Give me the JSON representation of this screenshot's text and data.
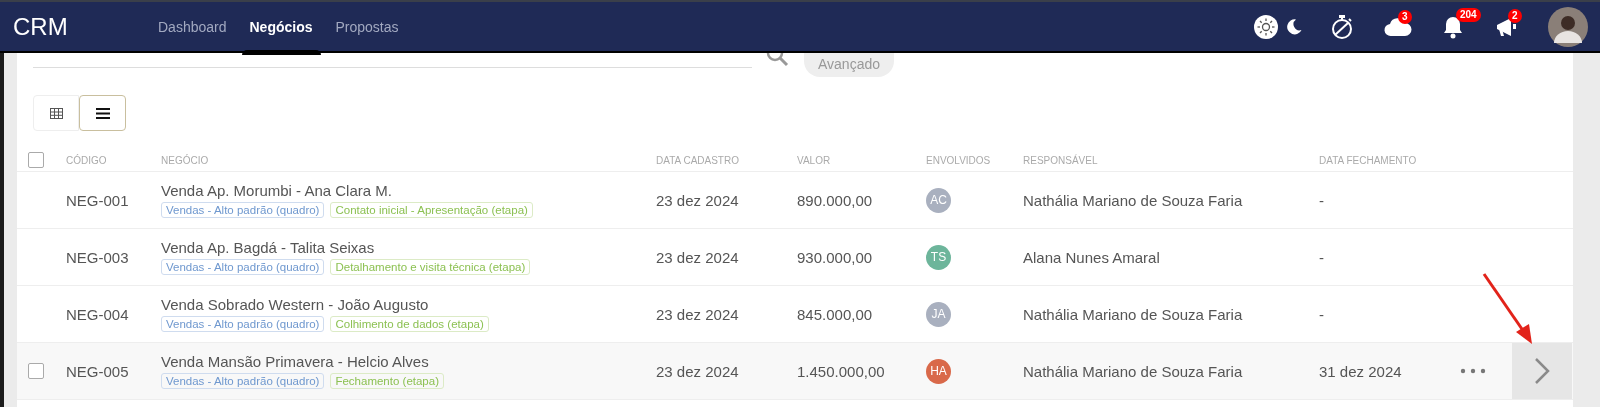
{
  "app": {
    "title": "CRM"
  },
  "nav": [
    {
      "label": "Dashboard",
      "selected": false
    },
    {
      "label": "Negócios",
      "selected": true
    },
    {
      "label": "Propostas",
      "selected": false
    }
  ],
  "theme_options": [
    {
      "kind": "sun",
      "selected": true
    },
    {
      "kind": "moon",
      "selected": false
    }
  ],
  "header_icons": [
    {
      "kind": "stopwatch"
    },
    {
      "kind": "cloud",
      "badge": "3"
    },
    {
      "kind": "bell",
      "badge": "204"
    },
    {
      "kind": "megaphone",
      "badge": "2"
    }
  ],
  "search": {
    "button": "Avançado"
  },
  "view_modes": [
    {
      "kind": "grid",
      "selected": false
    },
    {
      "kind": "list",
      "selected": true
    }
  ],
  "table": {
    "select_all_checked": false,
    "columns": [
      "CÓDIGO",
      "NEGÓCIO",
      "DATA CADASTRO",
      "VALOR",
      "ENVOLVIDOS",
      "RESPONSÁVEL",
      "DATA FECHAMENTO"
    ],
    "rows": [
      {
        "code": "NEG-001",
        "title": "Venda Ap. Morumbi - Ana Clara M.",
        "tags": [
          {
            "kind": "board",
            "text": "Vendas - Alto padrão (quadro)"
          },
          {
            "kind": "stage",
            "text": "Contato inicial - Apresentação (etapa)"
          }
        ],
        "created": "23 dez 2024",
        "value": "890.000,00",
        "involved": {
          "initials": "AC",
          "color": "#a9b0bf"
        },
        "owner": "Nathália Mariano de Souza Faria",
        "closing": "-",
        "hovered": false
      },
      {
        "code": "NEG-003",
        "title": "Venda Ap. Bagdá - Talita Seixas",
        "tags": [
          {
            "kind": "board",
            "text": "Vendas - Alto padrão (quadro)"
          },
          {
            "kind": "stage",
            "text": "Detalhamento e visita técnica (etapa)"
          }
        ],
        "created": "23 dez 2024",
        "value": "930.000,00",
        "involved": {
          "initials": "TS",
          "color": "#6db59b"
        },
        "owner": "Alana Nunes Amaral",
        "closing": "-",
        "hovered": false
      },
      {
        "code": "NEG-004",
        "title": "Venda Sobrado Western - João Augusto",
        "tags": [
          {
            "kind": "board",
            "text": "Vendas - Alto padrão (quadro)"
          },
          {
            "kind": "stage",
            "text": "Colhimento de dados (etapa)"
          }
        ],
        "created": "23 dez 2024",
        "value": "845.000,00",
        "involved": {
          "initials": "JA",
          "color": "#a9b0bf"
        },
        "owner": "Nathália Mariano de Souza Faria",
        "closing": "-",
        "hovered": false
      },
      {
        "code": "NEG-005",
        "title": "Venda Mansão Primavera - Helcio Alves",
        "tags": [
          {
            "kind": "board",
            "text": "Vendas - Alto padrão (quadro)"
          },
          {
            "kind": "stage",
            "text": "Fechamento (etapa)"
          }
        ],
        "created": "23 dez 2024",
        "value": "1.450.000,00",
        "involved": {
          "initials": "HA",
          "color": "#d9694a"
        },
        "owner": "Nathália Mariano de Souza Faria",
        "closing": "31 dez 2024",
        "hovered": true,
        "checked": false
      }
    ]
  }
}
